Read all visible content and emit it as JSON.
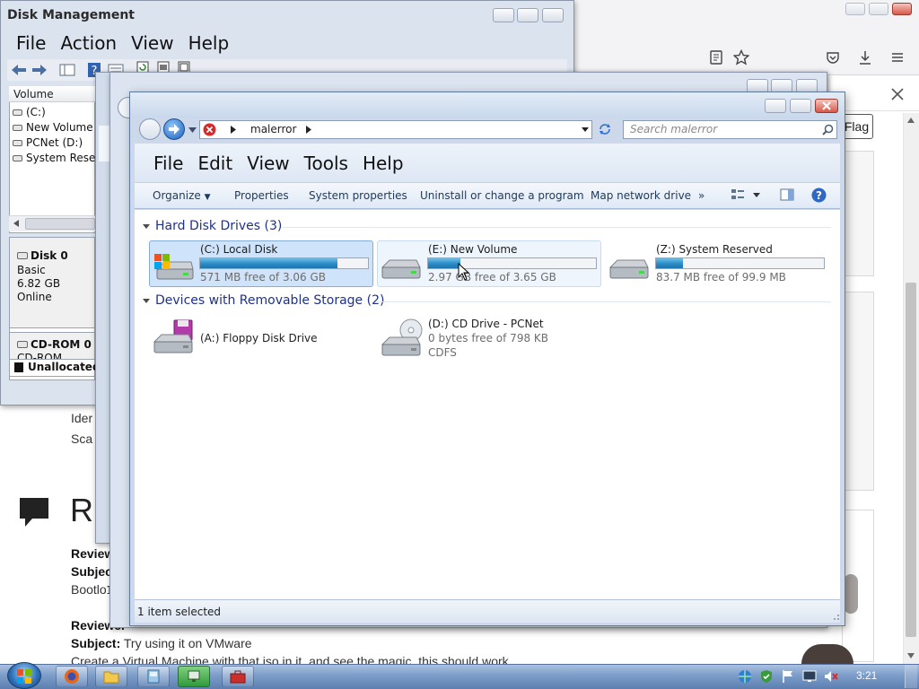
{
  "browser": {
    "flag_button": "Flag",
    "page_fragments": {
      "line1": "Ider",
      "line2": "Sca"
    },
    "review_heading": "R",
    "review_lines": [
      {
        "label": "Review",
        "text": ""
      },
      {
        "label": "Subjec",
        "text": ""
      },
      {
        "label": "",
        "text": "Bootlo"
      }
    ],
    "review2": {
      "reviewer_label": "Reviewer",
      "subject_label": "Subject:",
      "subject_text": "Try using it on VMware",
      "body": "Create a Virtual Machine with that iso in it, and see the magic, this should work"
    },
    "side_fragments": [
      "e",
      "e"
    ]
  },
  "disk_management": {
    "title": "Disk Management",
    "menu": [
      "File",
      "Action",
      "View",
      "Help"
    ],
    "column_header": "Volume",
    "volumes": [
      "(C:)",
      "New Volume (",
      "PCNet (D:)",
      "System Reserv"
    ],
    "disks": [
      {
        "name": "Disk 0",
        "type": "Basic",
        "size": "6.82 GB",
        "status": "Online"
      },
      {
        "name": "CD-ROM 0",
        "type": "CD-ROM"
      }
    ],
    "unallocated": "Unallocated"
  },
  "middle_window": {
    "status_fragment": "1 i"
  },
  "explorer": {
    "address": "malerror",
    "search_placeholder": "Search malerror",
    "menu": [
      "File",
      "Edit",
      "View",
      "Tools",
      "Help"
    ],
    "commands": [
      "Organize",
      "Properties",
      "System properties",
      "Uninstall or change a program",
      "Map network drive",
      "»"
    ],
    "groups": {
      "hard_disks": {
        "title": "Hard Disk Drives (3)",
        "drives": [
          {
            "name": "(C:) Local Disk",
            "free": "571 MB free of 3.06 GB",
            "used_fraction": 0.82,
            "selected": true
          },
          {
            "name": "(E:) New Volume",
            "free": "2.97 GB free of 3.65 GB",
            "used_fraction": 0.19,
            "hover": true
          },
          {
            "name": "(Z:) System Reserved",
            "free": "83.7 MB free of 99.9 MB",
            "used_fraction": 0.16
          }
        ]
      },
      "removable": {
        "title": "Devices with Removable Storage (2)",
        "devices": [
          {
            "name": "(A:) Floppy Disk Drive"
          },
          {
            "name": "(D:) CD Drive - PCNet",
            "free": "0 bytes free of 798 KB",
            "fs": "CDFS"
          }
        ]
      }
    },
    "status": "1 item selected"
  },
  "taskbar": {
    "clock": "3:21",
    "pinned": [
      "firefox-icon",
      "folder-icon",
      "virtualbox-icon",
      "network-icon",
      "toolbox-icon"
    ]
  },
  "colors": {
    "selected_tile": "#cfe4fb",
    "bar_fill": "#2a8bc6",
    "group_header": "#1e3287",
    "taskbar": "#7b9cc8"
  }
}
